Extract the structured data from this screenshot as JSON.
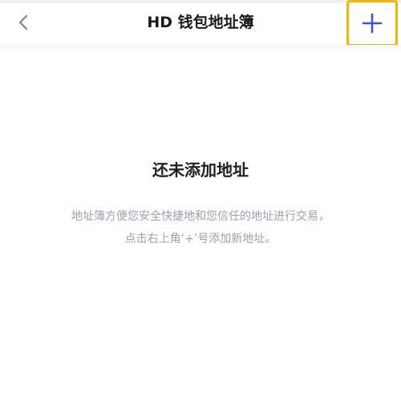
{
  "nav": {
    "title": "HD 钱包地址簿",
    "back_icon": "chevron-left-icon",
    "add_icon": "plus-icon"
  },
  "empty_state": {
    "title": "还未添加地址",
    "description_line1": "地址簿方便您安全快捷地和您信任的地址进行交易，",
    "description_line2": "点击右上角‘+’号添加新地址。"
  },
  "colors": {
    "accent": "#3b52e3",
    "highlight_border": "#f7b500",
    "title_text": "#1b1b1f",
    "description_text": "#9aa1b5",
    "back_icon": "#8b8f9a"
  }
}
